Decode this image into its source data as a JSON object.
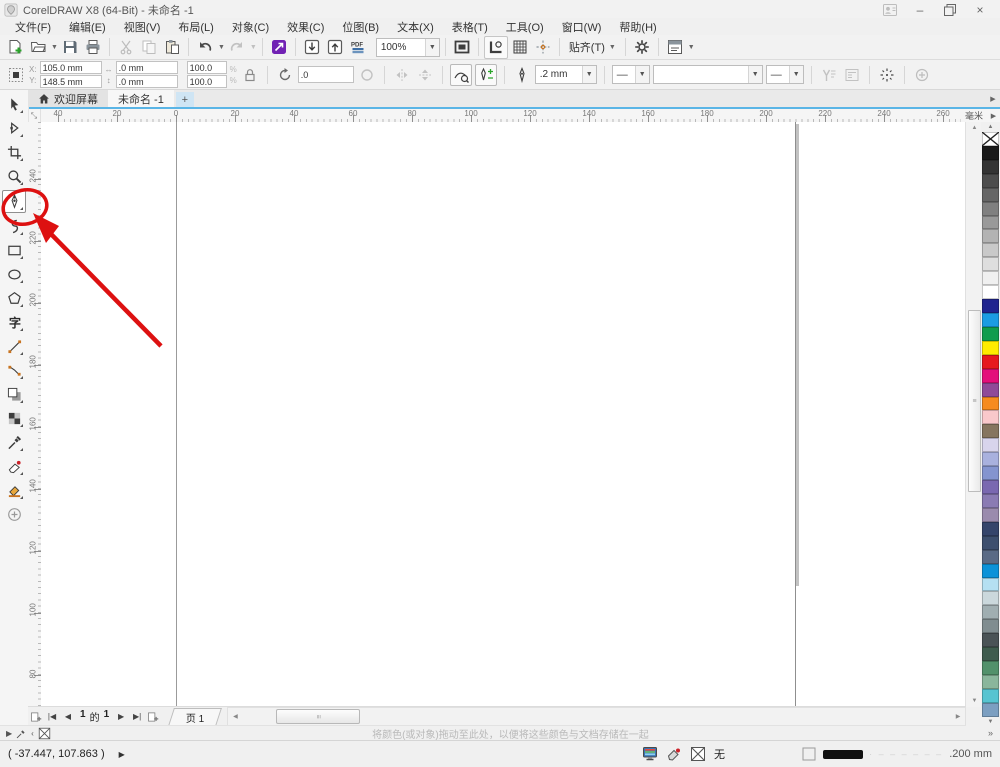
{
  "window": {
    "title": "CorelDRAW X8 (64-Bit) - 未命名 -1",
    "buttons": [
      "account",
      "minimize",
      "restore",
      "close"
    ]
  },
  "menubar": {
    "items": [
      {
        "name": "file",
        "label": "文件(F)"
      },
      {
        "name": "edit",
        "label": "编辑(E)"
      },
      {
        "name": "view",
        "label": "视图(V)"
      },
      {
        "name": "layout",
        "label": "布局(L)"
      },
      {
        "name": "object",
        "label": "对象(C)"
      },
      {
        "name": "effects",
        "label": "效果(C)"
      },
      {
        "name": "bitmaps",
        "label": "位图(B)"
      },
      {
        "name": "text",
        "label": "文本(X)"
      },
      {
        "name": "table",
        "label": "表格(T)"
      },
      {
        "name": "tools",
        "label": "工具(O)"
      },
      {
        "name": "window",
        "label": "窗口(W)"
      },
      {
        "name": "help",
        "label": "帮助(H)"
      }
    ]
  },
  "toolbar": {
    "zoom_level": "100%",
    "snap_label": "贴齐(T)"
  },
  "property_bar": {
    "x": "105.0 mm",
    "y": "148.5 mm",
    "width": ".0 mm",
    "height": ".0 mm",
    "scale_x": "100.0",
    "scale_y": "100.0",
    "angle": ".0",
    "outline_width": ".2 mm",
    "line_start": "—",
    "line_end": "—"
  },
  "tabs": {
    "welcome": "欢迎屏幕",
    "document": "未命名 -1",
    "new_label": "+"
  },
  "rulers": {
    "unit": "毫米",
    "horizontal_labels": [
      "40",
      "20",
      "0",
      "20",
      "40",
      "60",
      "80",
      "100",
      "120",
      "140",
      "160",
      "180",
      "200",
      "220",
      "240",
      "260"
    ],
    "vertical_labels": [
      "240",
      "220",
      "200",
      "180",
      "160",
      "140",
      "120",
      "100",
      "80"
    ]
  },
  "toolbox": {
    "tools": [
      {
        "name": "pick-tool",
        "icon": "pick"
      },
      {
        "name": "shape-tool",
        "icon": "shape"
      },
      {
        "name": "crop-tool",
        "icon": "crop"
      },
      {
        "name": "zoom-tool",
        "icon": "zoomt"
      },
      {
        "name": "freehand-tool",
        "icon": "pen",
        "selected": true
      },
      {
        "name": "artistic-media-tool",
        "icon": "artistic"
      },
      {
        "name": "rectangle-tool",
        "icon": "rectangle"
      },
      {
        "name": "ellipse-tool",
        "icon": "ellipset"
      },
      {
        "name": "polygon-tool",
        "icon": "polygon"
      },
      {
        "name": "text-tool",
        "icon": "textt"
      },
      {
        "name": "dimension-tool",
        "icon": "dimension"
      },
      {
        "name": "connector-tool",
        "icon": "connector"
      },
      {
        "name": "drop-shadow-tool",
        "icon": "shadow"
      },
      {
        "name": "transparency-tool",
        "icon": "transparency"
      },
      {
        "name": "color-eyedropper-tool",
        "icon": "eyedropper"
      },
      {
        "name": "interactive-fill-tool",
        "icon": "fill"
      },
      {
        "name": "smart-fill-tool",
        "icon": "smartfill"
      },
      {
        "name": "add-tools-button",
        "icon": "plustool",
        "noflyout": true
      }
    ]
  },
  "palette": {
    "colors": [
      "none",
      "#1a1a1a",
      "#343434",
      "#4d4d4d",
      "#666666",
      "#808080",
      "#999999",
      "#b3b3b3",
      "#c9c9c9",
      "#dedede",
      "#f0f0f0",
      "#ffffff",
      "#20248f",
      "#1b9ce3",
      "#109c4e",
      "#ffec00",
      "#e6191e",
      "#e30f7b",
      "#8f4a98",
      "#f68b1f",
      "#f9c8cb",
      "#86755f",
      "#d8d4ec",
      "#a9b1de",
      "#8494cf",
      "#7a68b0",
      "#8a7bb3",
      "#9a8bad",
      "#35456b",
      "#3d4f6e",
      "#5a6a85",
      "#0c92d8",
      "#b5e0f2",
      "#cbd8dc",
      "#a0aeb1",
      "#808d90",
      "#4a5356",
      "#3f5c4e",
      "#52916b",
      "#8ab69c",
      "#57c4d1",
      "#7c9fc1"
    ]
  },
  "page_nav": {
    "current": "1",
    "of_label": "的",
    "total": "1",
    "page_tab": "页 1"
  },
  "doc_palette": {
    "hint": "将颜色(或对象)拖动至此处，以便将这些颜色与文档存储在一起"
  },
  "status_bar": {
    "coords": "( -37.447, 107.863 )",
    "fill_none_label": "无",
    "outline_value": ".200 mm"
  },
  "annotation": {
    "color": "#dd1111",
    "target": "freehand-tool"
  }
}
